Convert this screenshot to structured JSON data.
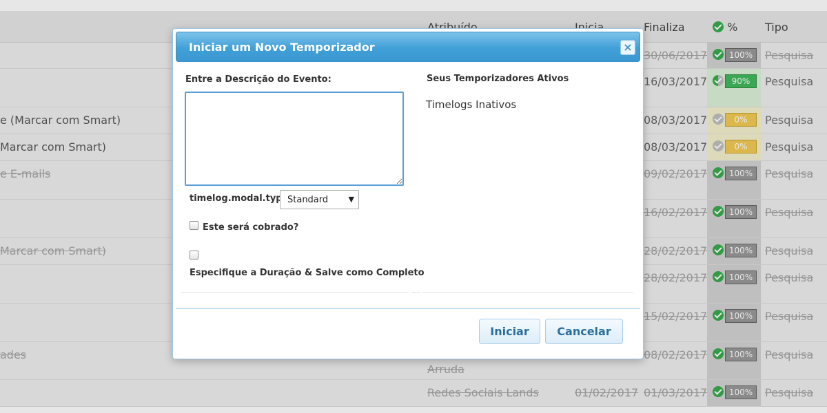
{
  "table": {
    "headers": {
      "assigned": "Atribuído",
      "starts": "Inicia",
      "ends": "Finaliza",
      "percent": "%",
      "type": "Tipo"
    },
    "rows": [
      {
        "task": "",
        "assigned": "",
        "assigned2": "",
        "start": "",
        "end": "30/06/2017",
        "percent": "100%",
        "percent_value": 100,
        "status": "done",
        "type": "Pesquisa"
      },
      {
        "task": "",
        "assigned": "",
        "assigned2": "",
        "start": "",
        "end": "16/03/2017",
        "percent": "90%",
        "percent_value": 90,
        "status": "progress",
        "type": "Pesquisa"
      },
      {
        "task": "e (Marcar com Smart)",
        "assigned": "",
        "assigned2": "",
        "start": "",
        "end": "08/03/2017",
        "percent": "0%",
        "percent_value": 0,
        "status": "todo",
        "type": "Pesquisa"
      },
      {
        "task": "Marcar com Smart)",
        "assigned": "",
        "assigned2": "",
        "start": "",
        "end": "08/03/2017",
        "percent": "0%",
        "percent_value": 0,
        "status": "todo",
        "type": "Pesquisa"
      },
      {
        "task": "e E-mails",
        "assigned": "",
        "assigned2": "",
        "start": "",
        "end": "09/02/2017",
        "percent": "100%",
        "percent_value": 100,
        "status": "done",
        "type": "Pesquisa"
      },
      {
        "task": "",
        "assigned": "",
        "assigned2": "",
        "start": "",
        "end": "16/02/2017",
        "percent": "100%",
        "percent_value": 100,
        "status": "done",
        "type": "Pesquisa"
      },
      {
        "task": "Marcar com Smart)",
        "assigned": "",
        "assigned2": "",
        "start": "",
        "end": "28/02/2017",
        "percent": "100%",
        "percent_value": 100,
        "status": "done",
        "type": "Pesquisa"
      },
      {
        "task": "",
        "assigned": "",
        "assigned2": "",
        "start": "",
        "end": "28/02/2017",
        "percent": "100%",
        "percent_value": 100,
        "status": "done",
        "type": "Pesquisa"
      },
      {
        "task": "",
        "assigned": "",
        "assigned2": "",
        "start": "",
        "end": "15/02/2017",
        "percent": "100%",
        "percent_value": 100,
        "status": "done",
        "type": "Pesquisa"
      },
      {
        "task": "ades",
        "assigned": "",
        "assigned2": "Arruda",
        "start": "",
        "end": "08/02/2017",
        "percent": "100%",
        "percent_value": 100,
        "status": "done",
        "type": "Pesquisa"
      },
      {
        "task": "",
        "assigned": "Redes Sociais Lands",
        "assigned2": "",
        "start": "01/02/2017",
        "end": "01/03/2017",
        "percent": "100%",
        "percent_value": 100,
        "status": "done",
        "type": "Pesquisa"
      }
    ]
  },
  "modal": {
    "title": "Iniciar um Novo Temporizador",
    "close_symbol": "×",
    "description_label": "Entre a Descrição do Evento:",
    "description_value": "",
    "type_label": "timelog.modal.type:",
    "type_selected": "Standard",
    "billable_label": "Este será cobrado?",
    "complete_label": "Especifique a Duração & Salve como Completo",
    "active_timers_label": "Seus Temporizadores Ativos",
    "inactive_timelogs_label": "Timelogs Inativos",
    "start_button": "Iniciar",
    "cancel_button": "Cancelar"
  }
}
